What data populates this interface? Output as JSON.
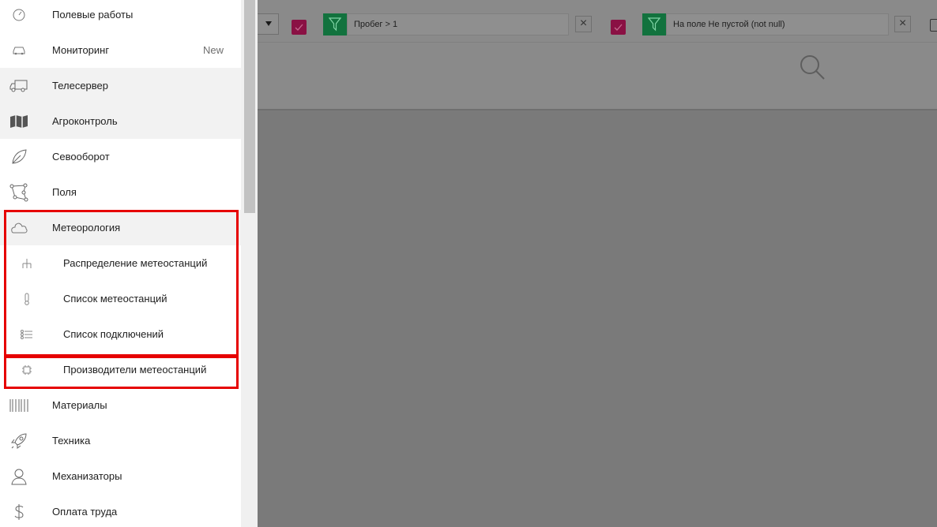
{
  "sidebar": {
    "items": [
      {
        "label": "Полевые работы",
        "icon": "gauge-icon"
      },
      {
        "label": "Мониторинг",
        "icon": "car-icon",
        "badge": "New"
      },
      {
        "label": "Телесервер",
        "icon": "truck-icon"
      },
      {
        "label": "Агроконтроль",
        "icon": "map-icon"
      },
      {
        "label": "Севооборот",
        "icon": "leaf-icon"
      },
      {
        "label": "Поля",
        "icon": "field-polygon-icon"
      },
      {
        "label": "Метеорология",
        "icon": "cloud-icon"
      },
      {
        "label": "Распределение метеостанций",
        "icon": "hierarchy-icon"
      },
      {
        "label": "Список метеостанций",
        "icon": "thermometer-icon"
      },
      {
        "label": "Список подключений",
        "icon": "list-icon"
      },
      {
        "label": "Производители метеостанций",
        "icon": "chip-icon"
      },
      {
        "label": "Материалы",
        "icon": "barcode-icon"
      },
      {
        "label": "Техника",
        "icon": "rocket-icon"
      },
      {
        "label": "Механизаторы",
        "icon": "person-icon"
      },
      {
        "label": "Оплата труда",
        "icon": "dollar-icon"
      }
    ]
  },
  "background": {
    "filters": [
      {
        "text": "Пробег > 1"
      },
      {
        "text": "На поле Не пустой (not null)"
      }
    ],
    "close_glyph": "×"
  },
  "colors": {
    "highlight": "#e60000",
    "checkbox": "#8a1144",
    "funnel": "#12723e",
    "overlay": "#7a7a7a"
  }
}
